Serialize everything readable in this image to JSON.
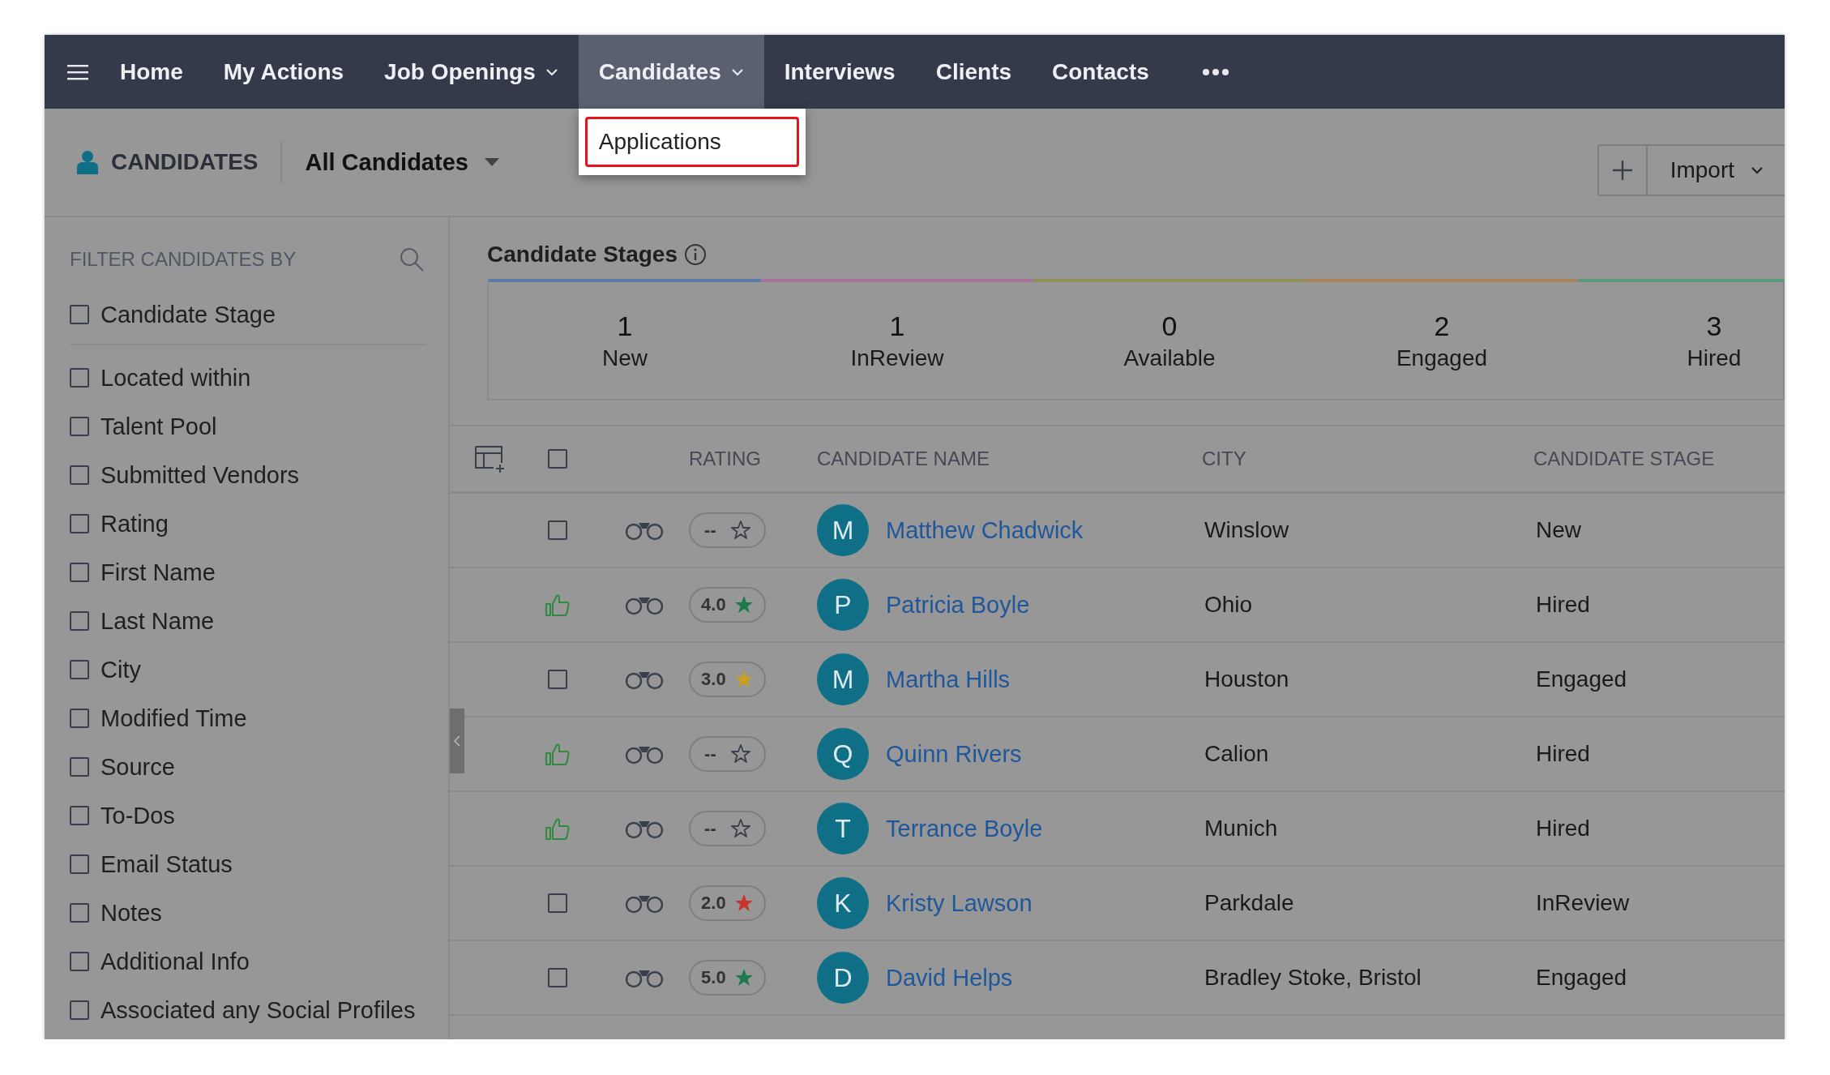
{
  "nav": {
    "items": [
      {
        "label": "Home",
        "selected": false,
        "has_menu": false
      },
      {
        "label": "My Actions",
        "selected": false,
        "has_menu": false
      },
      {
        "label": "Job Openings",
        "selected": false,
        "has_menu": true
      },
      {
        "label": "Candidates",
        "selected": true,
        "has_menu": true
      },
      {
        "label": "Interviews",
        "selected": false,
        "has_menu": false
      },
      {
        "label": "Clients",
        "selected": false,
        "has_menu": false
      },
      {
        "label": "Contacts",
        "selected": false,
        "has_menu": false
      }
    ]
  },
  "dropdown": {
    "items": [
      {
        "label": "Applications",
        "highlighted": true
      }
    ]
  },
  "header": {
    "module": "CANDIDATES",
    "view": "All Candidates",
    "import_button": "Import"
  },
  "filters": {
    "title": "FILTER CANDIDATES BY",
    "items": [
      {
        "label": "Candidate Stage",
        "checked": false
      },
      {
        "label": "Located within",
        "checked": false
      },
      {
        "label": "Talent Pool",
        "checked": false
      },
      {
        "label": "Submitted Vendors",
        "checked": false
      },
      {
        "label": "Rating",
        "checked": false
      },
      {
        "label": "First Name",
        "checked": false
      },
      {
        "label": "Last Name",
        "checked": false
      },
      {
        "label": "City",
        "checked": false
      },
      {
        "label": "Modified Time",
        "checked": false
      },
      {
        "label": "Source",
        "checked": false
      },
      {
        "label": "To-Dos",
        "checked": false
      },
      {
        "label": "Email Status",
        "checked": false
      },
      {
        "label": "Notes",
        "checked": false
      },
      {
        "label": "Additional Info",
        "checked": false
      },
      {
        "label": "Associated any Social Profiles",
        "checked": false
      }
    ]
  },
  "stages": {
    "title": "Candidate Stages",
    "items": [
      {
        "count": "1",
        "label": "New",
        "color": "#5b7ca8"
      },
      {
        "count": "1",
        "label": "InReview",
        "color": "#a8729a"
      },
      {
        "count": "0",
        "label": "Available",
        "color": "#8f8f5a"
      },
      {
        "count": "2",
        "label": "Engaged",
        "color": "#a8825a"
      },
      {
        "count": "3",
        "label": "Hired",
        "color": "#5a9a7a"
      }
    ]
  },
  "table": {
    "select_all": {
      "checked": false
    },
    "columns": [
      "RATING",
      "CANDIDATE NAME",
      "CITY",
      "CANDIDATE STAGE"
    ],
    "rows": [
      {
        "kind": "checkbox",
        "checked": false,
        "rating": "--",
        "initial": "M",
        "name": "Matthew Chadwick",
        "city": "Winslow",
        "stage": "New"
      },
      {
        "kind": "liked",
        "rating": "4.0",
        "color": "#1e7a4a",
        "initial": "P",
        "name": "Patricia Boyle",
        "city": "Ohio",
        "stage": "Hired"
      },
      {
        "kind": "checkbox",
        "checked": false,
        "rating": "3.0",
        "color": "#c9a020",
        "initial": "M",
        "name": "Martha Hills",
        "city": "Houston",
        "stage": "Engaged"
      },
      {
        "kind": "liked",
        "rating": "--",
        "initial": "Q",
        "name": "Quinn Rivers",
        "city": "Calion",
        "stage": "Hired"
      },
      {
        "kind": "liked",
        "rating": "--",
        "initial": "T",
        "name": "Terrance Boyle",
        "city": "Munich",
        "stage": "Hired"
      },
      {
        "kind": "checkbox",
        "checked": false,
        "rating": "2.0",
        "color": "#c8352b",
        "initial": "K",
        "name": "Kristy Lawson",
        "city": "Parkdale",
        "stage": "InReview"
      },
      {
        "kind": "checkbox",
        "checked": false,
        "rating": "5.0",
        "color": "#1e7a4a",
        "initial": "D",
        "name": "David Helps",
        "city": "Bradley Stoke, Bristol",
        "stage": "Engaged"
      }
    ]
  }
}
